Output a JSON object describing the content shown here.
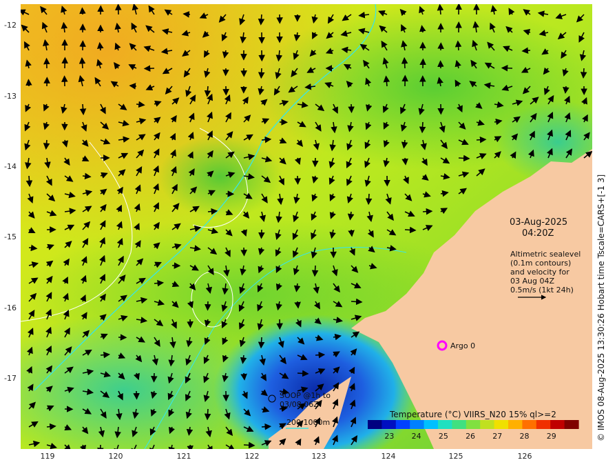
{
  "map": {
    "date_label": "03-Aug-2025",
    "time_label": "04:20Z",
    "altimetry_note": [
      "Altimetric sealevel",
      "(0.1m contours)",
      "and velocity for",
      "03 Aug 04Z",
      "0.5m/s (1kt 24h)"
    ],
    "soop_label": [
      "SOOP @1h to",
      "03/08 06Z"
    ],
    "argo_label": "Argo 0",
    "depth_legend": "200  1000m",
    "credit": "© IMOS 08-Aug-2025 13:30:26 Hobart time Tscale=CARS+[-1 3]",
    "x_ticks": [
      "119",
      "120",
      "121",
      "122",
      "123",
      "124",
      "125",
      "126"
    ],
    "y_ticks": [
      "-12",
      "-13",
      "-14",
      "-15",
      "-16",
      "-17"
    ],
    "colorbar": {
      "title": "Temperature (°C) VIIRS_N20 15% ql>=2",
      "ticks": [
        "23",
        "24",
        "25",
        "26",
        "27",
        "28",
        "29"
      ],
      "range": [
        22.2,
        30.0
      ]
    },
    "colors": {
      "land": "#f7c9a2",
      "argo_marker": "#ff00ff",
      "contour_200": "#39e6e6",
      "sealevel_contour": "#ffffff"
    }
  }
}
